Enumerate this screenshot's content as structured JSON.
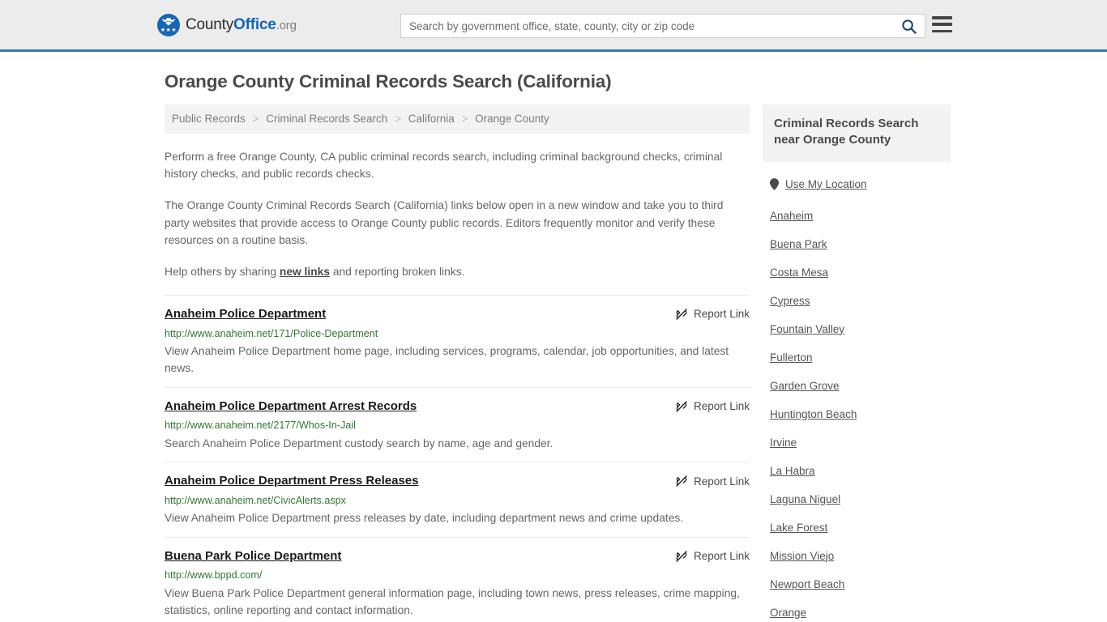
{
  "header": {
    "logo": {
      "part1": "County",
      "part2": "Office",
      "part3": ".org",
      "stars": "★★★"
    },
    "search": {
      "placeholder": "Search by government office, state, county, city or zip code",
      "value": ""
    },
    "colors": {
      "header_bg": "#ececec",
      "header_border": "#3b78ab",
      "brand_blue": "#1565b5",
      "url_green": "#2f7a32"
    }
  },
  "page": {
    "title": "Orange County Criminal Records Search (California)",
    "breadcrumb": {
      "separator": ">",
      "items": [
        "Public Records",
        "Criminal Records Search",
        "California",
        "Orange County"
      ]
    },
    "paragraphs": {
      "p1": "Perform a free Orange County, CA public criminal records search, including criminal background checks, criminal history checks, and public records checks.",
      "p2": "The Orange County Criminal Records Search (California) links below open in a new window and take you to third party websites that provide access to Orange County public records. Editors frequently monitor and verify these resources on a routine basis.",
      "p3_before": "Help others by sharing ",
      "p3_link": "new links",
      "p3_after": " and reporting broken links."
    }
  },
  "listings": {
    "report_label": "Report Link",
    "items": [
      {
        "title": "Anaheim Police Department",
        "url": "http://www.anaheim.net/171/Police-Department",
        "description": "View Anaheim Police Department home page, including services, programs, calendar, job opportunities, and latest news."
      },
      {
        "title": "Anaheim Police Department Arrest Records",
        "url": "http://www.anaheim.net/2177/Whos-In-Jail",
        "description": "Search Anaheim Police Department custody search by name, age and gender."
      },
      {
        "title": "Anaheim Police Department Press Releases",
        "url": "http://www.anaheim.net/CivicAlerts.aspx",
        "description": "View Anaheim Police Department press releases by date, including department news and crime updates."
      },
      {
        "title": "Buena Park Police Department",
        "url": "http://www.bppd.com/",
        "description": "View Buena Park Police Department general information page, including town news, press releases, crime mapping, statistics, online reporting and contact information."
      }
    ]
  },
  "sidebar": {
    "title": "Criminal Records Search near Orange County",
    "use_my_location": "Use My Location",
    "cities": [
      "Anaheim",
      "Buena Park",
      "Costa Mesa",
      "Cypress",
      "Fountain Valley",
      "Fullerton",
      "Garden Grove",
      "Huntington Beach",
      "Irvine",
      "La Habra",
      "Laguna Niguel",
      "Lake Forest",
      "Mission Viejo",
      "Newport Beach",
      "Orange"
    ]
  }
}
